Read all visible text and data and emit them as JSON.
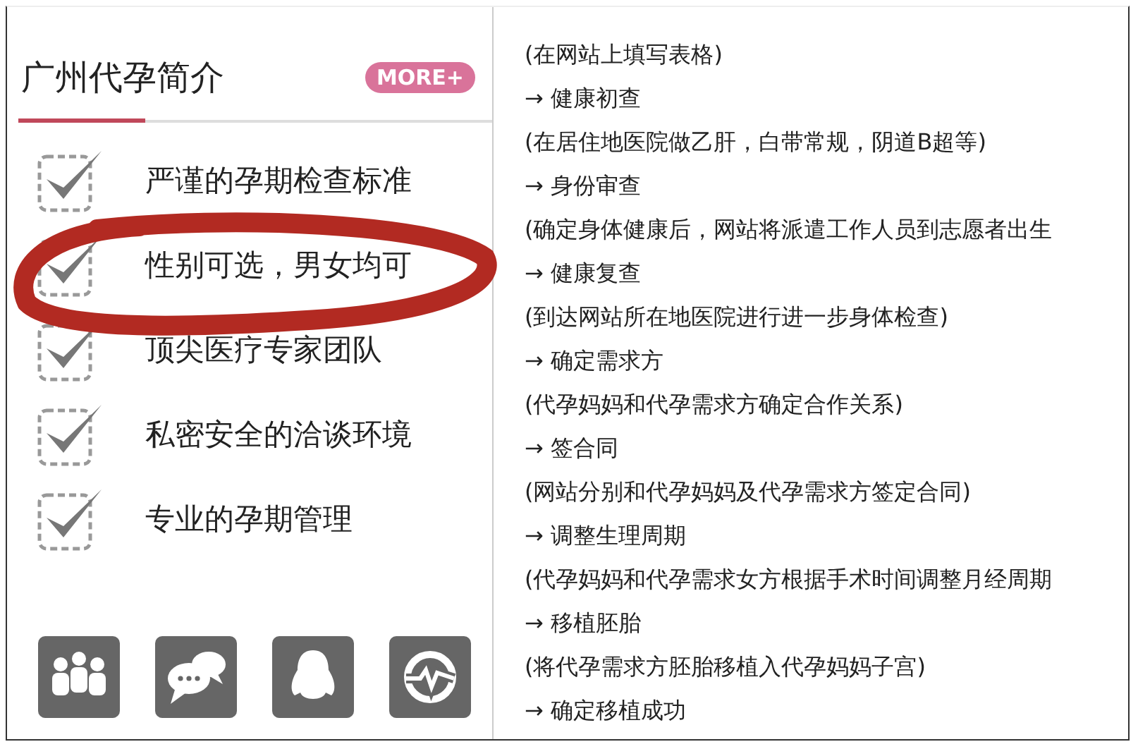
{
  "panel": {
    "title": "广州代孕简介",
    "more_button": "MORE+",
    "features": [
      {
        "label": "严谨的孕期检查标准",
        "checked": true
      },
      {
        "label": "性别可选，男女均可",
        "checked": true
      },
      {
        "label": "顶尖医疗专家团队",
        "checked": true
      },
      {
        "label": "私密安全的洽谈环境",
        "checked": true
      },
      {
        "label": "专业的孕期管理",
        "checked": true
      }
    ]
  },
  "steps": [
    "(在网站上填写表格)",
    "→ 健康初查",
    "(在居住地医院做乙肝，白带常规，阴道B超等)",
    "→ 身份审查",
    "(确定身体健康后，网站将派遣工作人员到志愿者出生",
    "→ 健康复查",
    "(到达网站所在地医院进行进一步身体检查)",
    "→ 确定需求方",
    "(代孕妈妈和代孕需求方确定合作关系)",
    "→ 签合同",
    "(网站分别和代孕妈妈及代孕需求方签定合同)",
    "→ 调整生理周期",
    "(代孕妈妈和代孕需求女方根据手术时间调整月经周期",
    "→ 移植胚胎",
    "(将代孕需求方胚胎移植入代孕妈妈子宫)",
    "→ 确定移植成功"
  ]
}
